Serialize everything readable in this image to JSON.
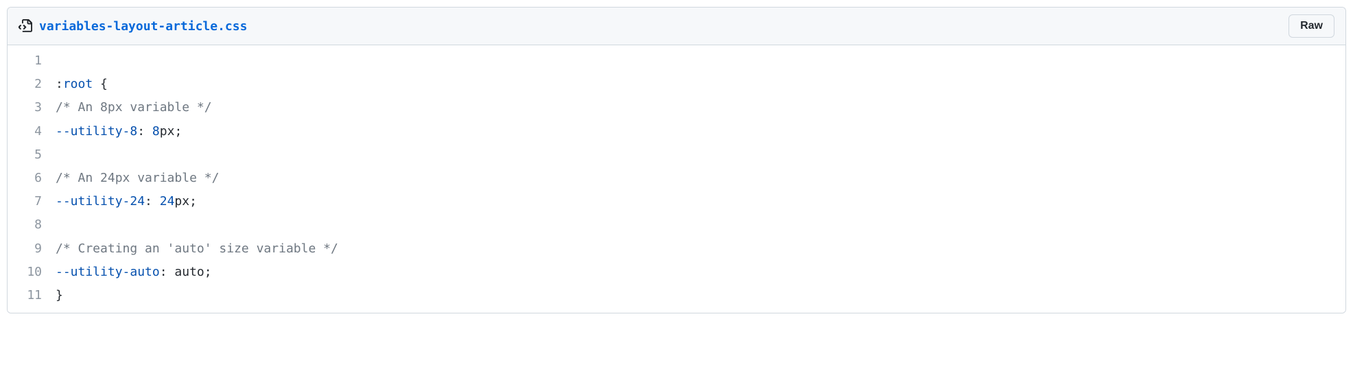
{
  "header": {
    "filename": "variables-layout-article.css",
    "raw_label": "Raw"
  },
  "code": {
    "lines": [
      {
        "num": "1",
        "tokens": []
      },
      {
        "num": "2",
        "tokens": [
          {
            "cls": "tok-punc",
            "t": ":"
          },
          {
            "cls": "tok-pseudo",
            "t": "root"
          },
          {
            "cls": "tok-punc",
            "t": " {"
          }
        ]
      },
      {
        "num": "3",
        "tokens": [
          {
            "cls": "tok-comment",
            "t": "/* An 8px variable */"
          }
        ]
      },
      {
        "num": "4",
        "tokens": [
          {
            "cls": "tok-var",
            "t": "--utility-8"
          },
          {
            "cls": "tok-punc",
            "t": ": "
          },
          {
            "cls": "tok-num",
            "t": "8"
          },
          {
            "cls": "tok-unit",
            "t": "px"
          },
          {
            "cls": "tok-punc",
            "t": ";"
          }
        ]
      },
      {
        "num": "5",
        "tokens": []
      },
      {
        "num": "6",
        "tokens": [
          {
            "cls": "tok-comment",
            "t": "/* An 24px variable */"
          }
        ]
      },
      {
        "num": "7",
        "tokens": [
          {
            "cls": "tok-var",
            "t": "--utility-24"
          },
          {
            "cls": "tok-punc",
            "t": ": "
          },
          {
            "cls": "tok-num",
            "t": "24"
          },
          {
            "cls": "tok-unit",
            "t": "px"
          },
          {
            "cls": "tok-punc",
            "t": ";"
          }
        ]
      },
      {
        "num": "8",
        "tokens": []
      },
      {
        "num": "9",
        "tokens": [
          {
            "cls": "tok-comment",
            "t": "/* Creating an 'auto' size variable */"
          }
        ]
      },
      {
        "num": "10",
        "tokens": [
          {
            "cls": "tok-var",
            "t": "--utility-auto"
          },
          {
            "cls": "tok-punc",
            "t": ": "
          },
          {
            "cls": "tok-plain",
            "t": "auto"
          },
          {
            "cls": "tok-punc",
            "t": ";"
          }
        ]
      },
      {
        "num": "11",
        "tokens": [
          {
            "cls": "tok-punc",
            "t": "}"
          }
        ]
      }
    ]
  }
}
